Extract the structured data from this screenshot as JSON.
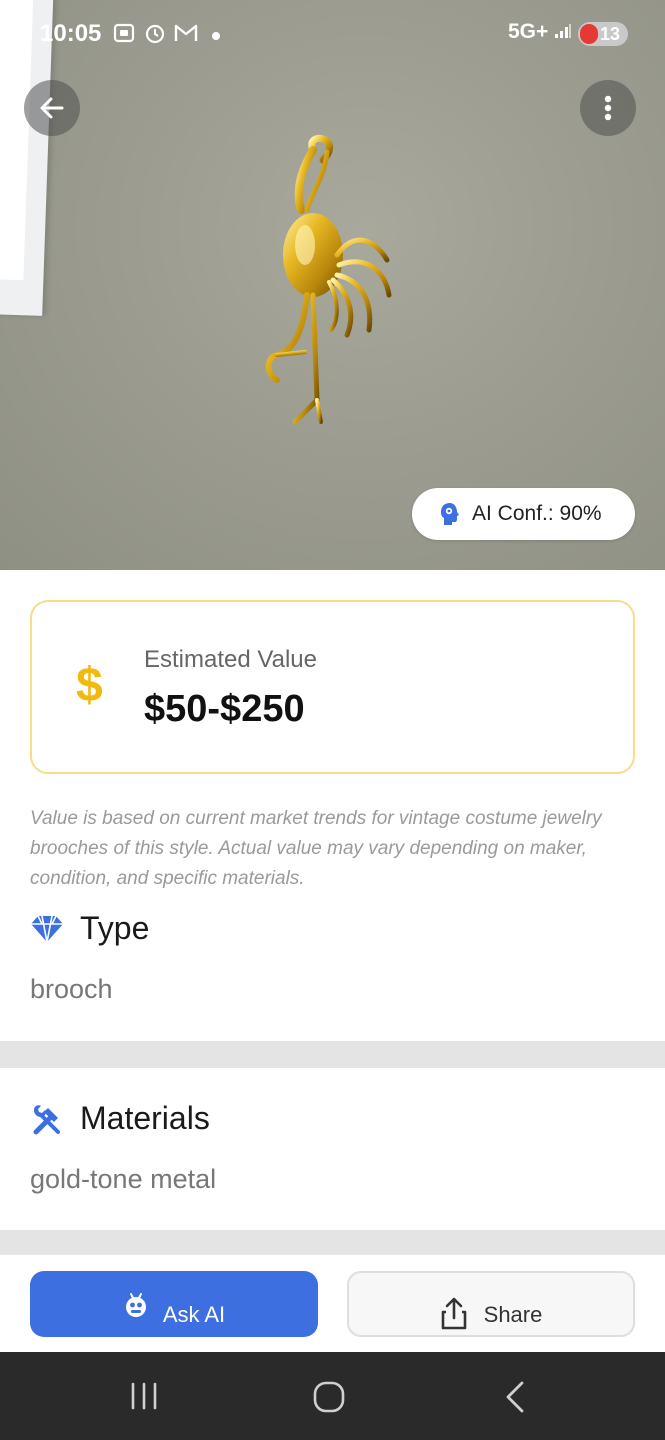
{
  "status_bar": {
    "time": "10:05",
    "network": "5G+",
    "battery": "13"
  },
  "hero": {
    "ai_confidence": "AI Conf.: 90%"
  },
  "estimate": {
    "currency_symbol": "$",
    "label": "Estimated Value",
    "amount": "$50-$250"
  },
  "disclaimer": "Value is based on current market trends for vintage costume jewelry brooches of this style. Actual value may vary depending on maker, condition, and specific materials.",
  "sections": {
    "type": {
      "title": "Type",
      "value": "brooch"
    },
    "materials": {
      "title": "Materials",
      "value": "gold-tone metal"
    }
  },
  "actions": {
    "ask_ai": "Ask AI",
    "share": "Share"
  },
  "colors": {
    "primary": "#3d6fe0",
    "accent_gold": "#f2b90f",
    "card_border": "#f7dc8a",
    "icon_blue": "#3d6fe0"
  },
  "icons": {
    "back": "arrow-left-icon",
    "more": "more-vert-icon",
    "ai": "ai-head-icon",
    "dollar": "dollar-icon",
    "type": "diamond-icon",
    "materials": "tools-icon",
    "ask_ai": "robot-icon",
    "share": "share-icon"
  }
}
